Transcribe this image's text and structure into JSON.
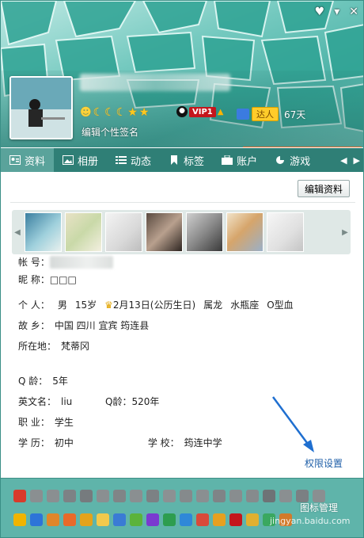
{
  "window": {
    "controls": [
      "♥",
      "▾",
      "✕"
    ]
  },
  "profile": {
    "signature": "编辑个性签名",
    "level_icons": [
      "sun",
      "moon",
      "moon",
      "moon",
      "star",
      "star"
    ],
    "vip_label": "VIP1",
    "daren_label": "达人",
    "daren_days": "67天"
  },
  "tabs": [
    {
      "label": "资料",
      "icon": "id-card-icon"
    },
    {
      "label": "相册",
      "icon": "photo-icon"
    },
    {
      "label": "动态",
      "icon": "list-icon"
    },
    {
      "label": "标签",
      "icon": "bookmark-icon"
    },
    {
      "label": "账户",
      "icon": "wallet-icon"
    },
    {
      "label": "游戏",
      "icon": "game-icon"
    }
  ],
  "content": {
    "edit_button": "编辑资料",
    "fields": {
      "account_label": "帐    号：",
      "nickname_label": "昵    称：",
      "nickname_value": "□□□",
      "personal_label": "个    人：",
      "gender": "男",
      "age": "15岁",
      "birthday": "2月13日(公历生日)",
      "zodiac": "属龙",
      "constellation": "水瓶座",
      "blood": "O型血",
      "hometown_label": "故    乡：",
      "hometown_value": "中国 四川 宜宾 筠连县",
      "location_label": "所在地：",
      "location_value": "梵蒂冈",
      "qage_label": "Q    龄：",
      "qage_value": "5年",
      "english_label": "英文名：",
      "english_value": "liu",
      "english_qage": "Q龄：520年",
      "job_label": "职    业：",
      "job_value": "学生",
      "edu_label": "学    历：",
      "edu_value": "初中",
      "school_label": "学    校：",
      "school_value": "筠连中学"
    },
    "permission_link": "权限设置"
  },
  "bottom": {
    "management": "图标管理"
  },
  "watermark": "jingyan.baidu.com",
  "colors": {
    "tab_bar": "#2f7f76",
    "tab_active": "#5aa39b",
    "icon_bar": "#5fb4aa",
    "link": "#1f5fa8",
    "accent": "#e86a2a"
  }
}
